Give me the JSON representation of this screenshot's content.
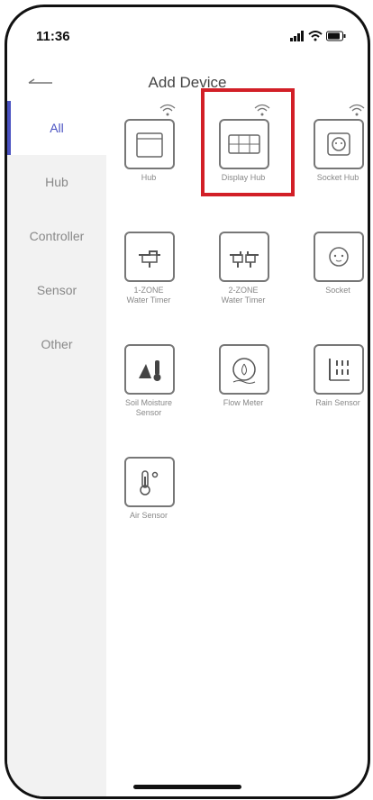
{
  "status_bar": {
    "time": "11:36"
  },
  "header": {
    "title": "Add Device"
  },
  "sidebar": {
    "items": [
      {
        "label": "All"
      },
      {
        "label": "Hub"
      },
      {
        "label": "Controller"
      },
      {
        "label": "Sensor"
      },
      {
        "label": "Other"
      }
    ]
  },
  "devices": [
    {
      "label": "Hub"
    },
    {
      "label": "Display Hub"
    },
    {
      "label": "Socket Hub"
    },
    {
      "label": "1-ZONE\nWater Timer"
    },
    {
      "label": "2-ZONE\nWater Timer"
    },
    {
      "label": "Socket"
    },
    {
      "label": "Soil Moisture\nSensor"
    },
    {
      "label": "Flow Meter"
    },
    {
      "label": "Rain Sensor"
    },
    {
      "label": "Air Sensor"
    }
  ],
  "colors": {
    "accent": "#4a52c2",
    "highlight": "#d21f27"
  }
}
